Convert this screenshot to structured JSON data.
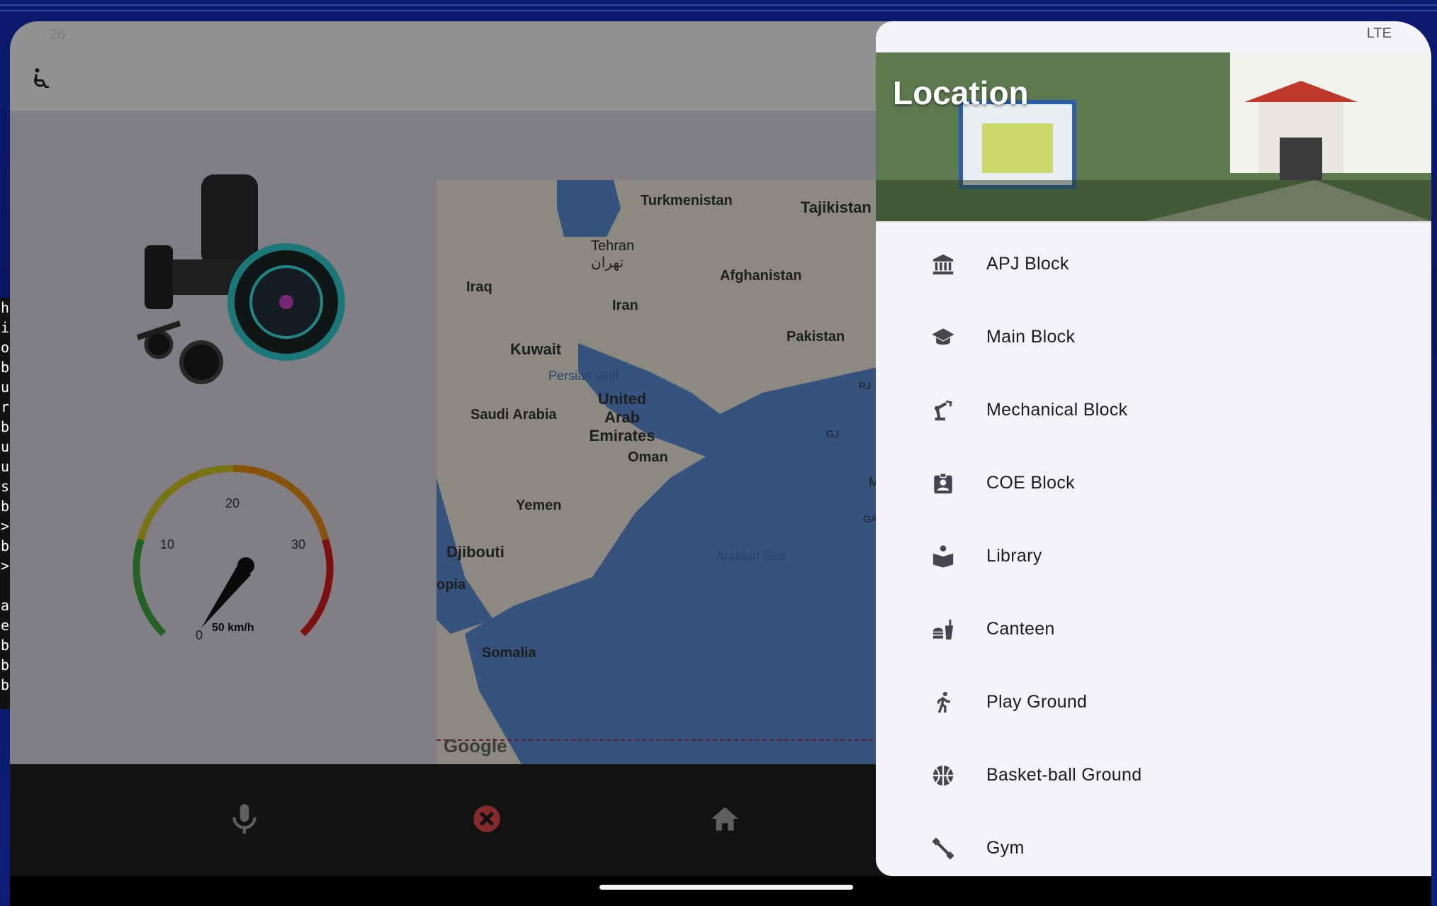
{
  "side_strip_chars": [
    "h",
    "i",
    "o",
    "b",
    "u",
    "r",
    "b",
    "u",
    "u",
    "s",
    "b",
    ">",
    "b",
    ">",
    "",
    "a",
    "e",
    "b",
    "b",
    "b"
  ],
  "status": {
    "left": "26",
    "network": "LTE"
  },
  "main": {
    "gauge": {
      "ticks": [
        "0",
        "10",
        "20",
        "30"
      ],
      "unit_label": "50 km/h"
    },
    "map": {
      "labels": {
        "turkmenistan": "Turkmenistan",
        "tajikistan": "Tajikistan",
        "tehran": "Tehran",
        "tehran_local": "تهران",
        "iraq": "Iraq",
        "iran": "Iran",
        "afghanistan": "Afghanistan",
        "kuwait": "Kuwait",
        "pakistan": "Pakistan",
        "persian_gulf": "Persian Gulf",
        "uae": "United Arab Emirates",
        "saudi": "Saudi Arabia",
        "oman": "Oman",
        "yemen": "Yemen",
        "djibouti": "Djibouti",
        "ethiopia": "opia",
        "arabian_sea": "Arabian Sea",
        "somalia": "Somalia",
        "rj": "RJ",
        "gj": "GJ",
        "mu": "Mu",
        "ga": "GA"
      },
      "attribution": "Google"
    }
  },
  "drawer": {
    "title": "Location",
    "items": [
      {
        "label": "APJ Block",
        "icon": "institution-icon"
      },
      {
        "label": "Main Block",
        "icon": "graduation-cap-icon"
      },
      {
        "label": "Mechanical Block",
        "icon": "robot-arm-icon"
      },
      {
        "label": "COE Block",
        "icon": "badge-icon"
      },
      {
        "label": "Library",
        "icon": "reader-icon"
      },
      {
        "label": "Canteen",
        "icon": "fastfood-icon"
      },
      {
        "label": "Play Ground",
        "icon": "run-icon"
      },
      {
        "label": "Basket-ball Ground",
        "icon": "basketball-icon"
      },
      {
        "label": "Gym",
        "icon": "dumbbell-icon"
      }
    ]
  },
  "colors": {
    "drawer_bg": "#f6f2fa",
    "nav_cancel": "#e04848",
    "gauge_green": "#3aa33a",
    "gauge_red": "#d11a1a"
  }
}
